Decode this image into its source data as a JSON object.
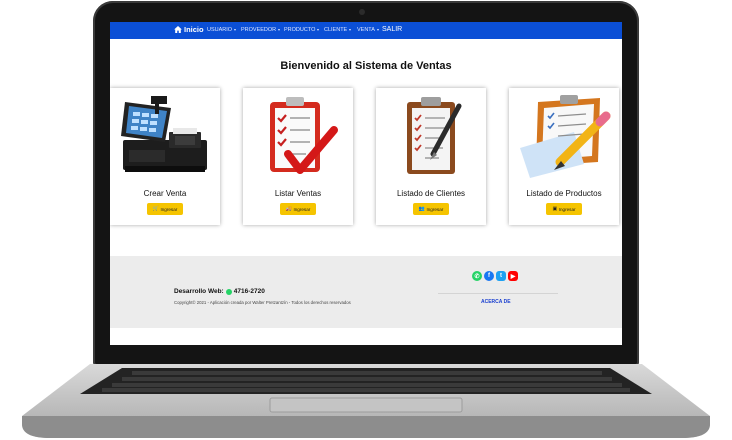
{
  "navbar": {
    "home_label": "Inicio",
    "items": [
      {
        "label": "USUARIO"
      },
      {
        "label": "PROVEEDOR"
      },
      {
        "label": "PRODUCTO"
      },
      {
        "label": "CLIENTE"
      },
      {
        "label": "VENTA"
      }
    ],
    "exit_label": "SALIR",
    "color": "#0b4fd6"
  },
  "main": {
    "title": "Bienvenido al Sistema de Ventas",
    "cards": [
      {
        "title": "Crear Venta",
        "button_label": "Ingresar",
        "icon": "cart-icon"
      },
      {
        "title": "Listar Ventas",
        "button_label": "Ingresar",
        "icon": "truck-icon"
      },
      {
        "title": "Listado de Clientes",
        "button_label": "Ingresar",
        "icon": "users-icon"
      },
      {
        "title": "Listado de Productos",
        "button_label": "Ingresar",
        "icon": "boxes-icon"
      }
    ],
    "button_color": "#f5c400"
  },
  "footer": {
    "dev_label": "Desarrollo Web:",
    "phone": "4716-2720",
    "copyright": "Copyright© 2021 - Aplicación creada por Walter Pretzantzín - Todos los derechos reservados",
    "about_label": "ACERCA DE",
    "social": [
      "whatsapp-icon",
      "facebook-icon",
      "twitter-icon",
      "youtube-icon"
    ]
  }
}
